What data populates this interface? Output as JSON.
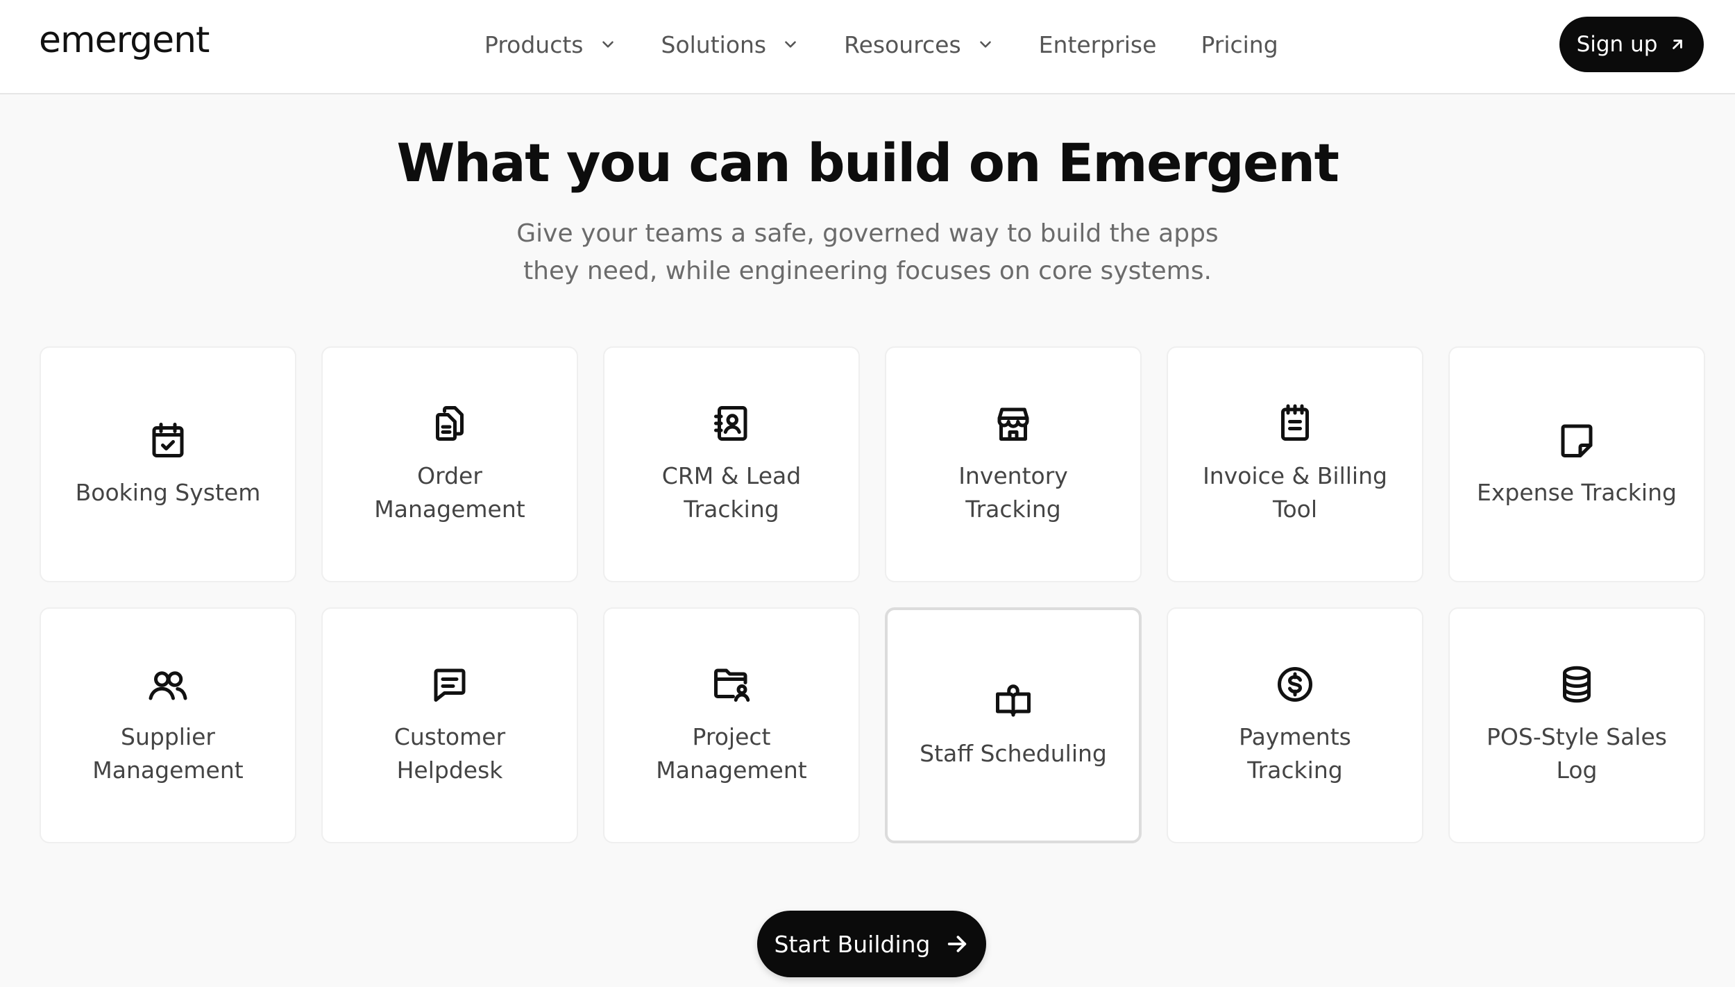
{
  "header": {
    "logo": "emergent",
    "nav": [
      {
        "label": "Products",
        "has_dropdown": true
      },
      {
        "label": "Solutions",
        "has_dropdown": true
      },
      {
        "label": "Resources",
        "has_dropdown": true
      },
      {
        "label": "Enterprise",
        "has_dropdown": false
      },
      {
        "label": "Pricing",
        "has_dropdown": false
      }
    ],
    "signup_label": "Sign up",
    "signup_icon": "arrow-up-right-icon"
  },
  "hero": {
    "title": "What you can build on Emergent",
    "subtitle_line1": "Give your teams a safe, governed way to build the apps",
    "subtitle_line2": "they need, while engineering focuses on core systems."
  },
  "cards": [
    {
      "label": "Booking System",
      "icon": "calendar-check-icon"
    },
    {
      "label": "Order Management",
      "icon": "documents-icon"
    },
    {
      "label": "CRM & Lead Tracking",
      "icon": "contact-book-icon"
    },
    {
      "label": "Inventory Tracking",
      "icon": "store-icon"
    },
    {
      "label": "Invoice & Billing Tool",
      "icon": "notepad-icon"
    },
    {
      "label": "Expense Tracking",
      "icon": "sticky-note-icon"
    },
    {
      "label": "Supplier Management",
      "icon": "users-icon"
    },
    {
      "label": "Customer Helpdesk",
      "icon": "message-icon"
    },
    {
      "label": "Project Management",
      "icon": "folder-user-icon"
    },
    {
      "label": "Staff Scheduling",
      "icon": "book-open-icon",
      "highlighted": true
    },
    {
      "label": "Payments Tracking",
      "icon": "dollar-circle-icon"
    },
    {
      "label": "POS-Style Sales Log",
      "icon": "database-icon"
    }
  ],
  "cta": {
    "label": "Start Building",
    "icon": "arrow-right-icon"
  },
  "colors": {
    "background": "#f9f9f9",
    "button_bg": "#0b0b0b",
    "card_bg": "#ffffff"
  }
}
